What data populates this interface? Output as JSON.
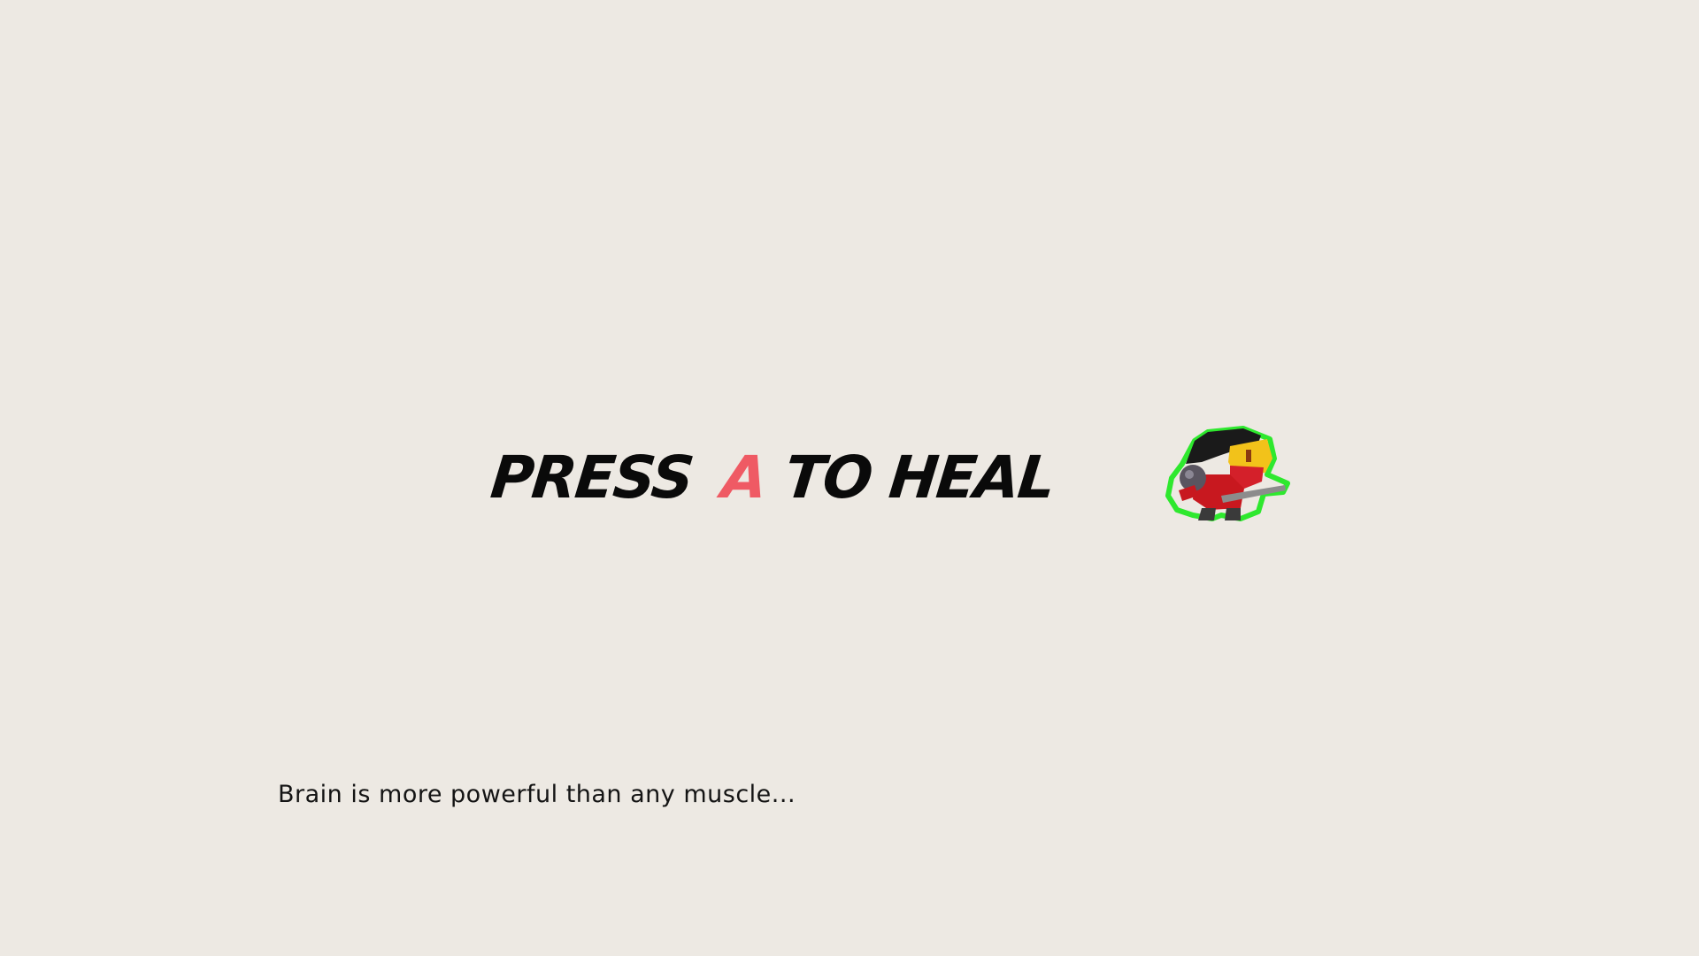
{
  "prompt": {
    "prefix": "PRESS",
    "key": "A",
    "suffix": "TO HEAL"
  },
  "hint": {
    "text": "Brain is more powerful than any muscle..."
  },
  "colors": {
    "background": "#ede9e3",
    "key_accent": "#ef5a64",
    "text": "#0a0a0a",
    "hero_outline": "#2ee82e"
  },
  "icons": {
    "hero": "ninja-character-sprite"
  }
}
